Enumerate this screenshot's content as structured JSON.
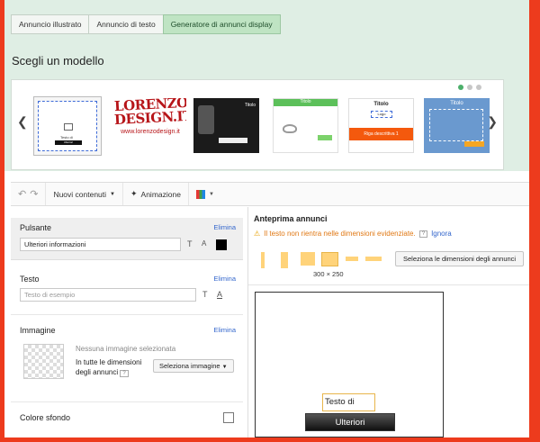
{
  "tabs": [
    "Annuncio illustrato",
    "Annuncio di testo",
    "Generatore di annunci display"
  ],
  "active_tab_index": 2,
  "heading": "Scegli un modello",
  "gallery": {
    "thumb0_label": "Testo di",
    "thumb0_button": "Ulteriori",
    "lorenzo_line1": "LORENZO",
    "lorenzo_line2": "DESIGN.IT",
    "lorenzo_url": "www.lorenzodesign.it",
    "thumb2_title": "Titolo",
    "thumb3_title": "Titolo",
    "thumb4_title": "Titolo",
    "thumb4_logo": "Logo",
    "thumb4_band": "Riga descrittiva 1",
    "thumb5_title": "Titolo",
    "page_dots": 3,
    "active_dot": 0
  },
  "toolbar": {
    "new_content": "Nuovi contenuti",
    "animation": "Animazione"
  },
  "left": {
    "button_section": {
      "title": "Pulsante",
      "remove": "Elimina",
      "value": "Ulteriori informazioni"
    },
    "text_section": {
      "title": "Testo",
      "remove": "Elimina",
      "placeholder": "Testo di esempio"
    },
    "image_section": {
      "title": "Immagine",
      "remove": "Elimina",
      "none_selected": "Nessuna immagine selezionata",
      "all_sizes": "In tutte le dimensioni degli annunci",
      "help": "?",
      "select_button": "Seleziona immagine"
    },
    "bg_section": {
      "title": "Colore sfondo"
    }
  },
  "right": {
    "title": "Anteprima annunci",
    "warning": "Il testo non rientra nelle dimensioni evidenziate.",
    "help": "?",
    "ignore": "Ignora",
    "selected_size": "300 × 250",
    "select_sizes_button": "Seleziona le dimensioni degli annunci",
    "preview_text": "Testo di",
    "preview_button": "Ulteriori"
  },
  "colors": {
    "accent_green": "#4caf6a",
    "warning_orange": "#e07814",
    "link_blue": "#3366cc",
    "frame_red": "#ed3b1d"
  }
}
